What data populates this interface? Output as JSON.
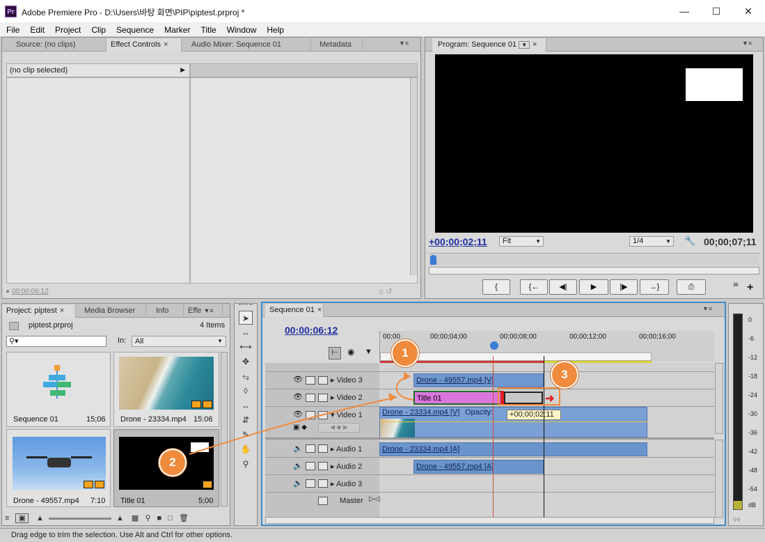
{
  "window": {
    "title": "Adobe Premiere Pro - D:\\Users\\바탕 화면\\PIP\\piptest.prproj *",
    "logo": "Pr",
    "minimize_icon": "minimize-icon",
    "maximize_icon": "maximize-icon",
    "close_icon": "close-icon"
  },
  "menu": [
    "File",
    "Edit",
    "Project",
    "Clip",
    "Sequence",
    "Marker",
    "Title",
    "Window",
    "Help"
  ],
  "source_panel": {
    "tabs": [
      "Source: (no clips)",
      "Effect Controls",
      "Audio Mixer: Sequence 01",
      "Metadata"
    ],
    "active_tab_close": "×",
    "no_clip": "(no clip selected)",
    "timecode": "00:00:06:12"
  },
  "program_panel": {
    "tab": "Program: Sequence 01",
    "tab_close": "×",
    "timecode_current": "+00;00;02;11",
    "fit_select": "Fit",
    "resolution_select": "1/4",
    "timecode_duration": "00;00;07;11",
    "transport": [
      "{",
      "{←",
      "◀|",
      "▶",
      "|▶",
      "→}",
      "⎙"
    ],
    "more": "»",
    "add": "+"
  },
  "project_panel": {
    "tabs": [
      "Project: piptest",
      "Media Browser",
      "Info",
      "Effe"
    ],
    "project_name": "piptest.prproj",
    "item_count": "4 Items",
    "in_label": "In:",
    "in_select": "All",
    "items": [
      {
        "name": "Sequence 01",
        "duration": "15;06"
      },
      {
        "name": "Drone - 23334.mp4",
        "duration": "15:06"
      },
      {
        "name": "Drone - 49557.mp4",
        "duration": "7:10"
      },
      {
        "name": "Title 01",
        "duration": "5;00"
      }
    ]
  },
  "timeline": {
    "tab": "Sequence 01",
    "tab_close": "×",
    "timecode": "00:00:06:12",
    "ruler": [
      "00;00",
      "00;00;04;00",
      "00;00;08;00",
      "00;00;12;00",
      "00;00;16;00"
    ],
    "tracks": {
      "video3": "Video 3",
      "video2": "Video 2",
      "video1": "Video 1",
      "audio1": "Audio 1",
      "audio2": "Audio 2",
      "audio3": "Audio 3",
      "master": "Master"
    },
    "clips": {
      "v3": "Drone - 49557.mp4 [V]",
      "v2": "Title 01",
      "v1": "Drone - 23334.mp4 [V]",
      "v1_opacity": "Opacity:",
      "a1": "Drone - 23334.mp4 [A]",
      "a2": "Drone - 49557.mp4 [A]"
    },
    "trim_tooltip": "+00;00;02;11"
  },
  "meters": {
    "ticks": [
      "0",
      "-6",
      "-12",
      "-18",
      "-24",
      "-30",
      "-36",
      "-42",
      "-48",
      "-54",
      "dB"
    ]
  },
  "callouts": [
    "1",
    "2",
    "3"
  ],
  "status": "Drag edge to trim the selection. Use Alt and Ctrl for other options.",
  "colors": {
    "accent_orange": "#f08a3c",
    "clip_video": "#6f97cf",
    "clip_title": "#dc76df",
    "timecode_blue": "#1d2e9e",
    "playhead": "#3a7bd5"
  }
}
